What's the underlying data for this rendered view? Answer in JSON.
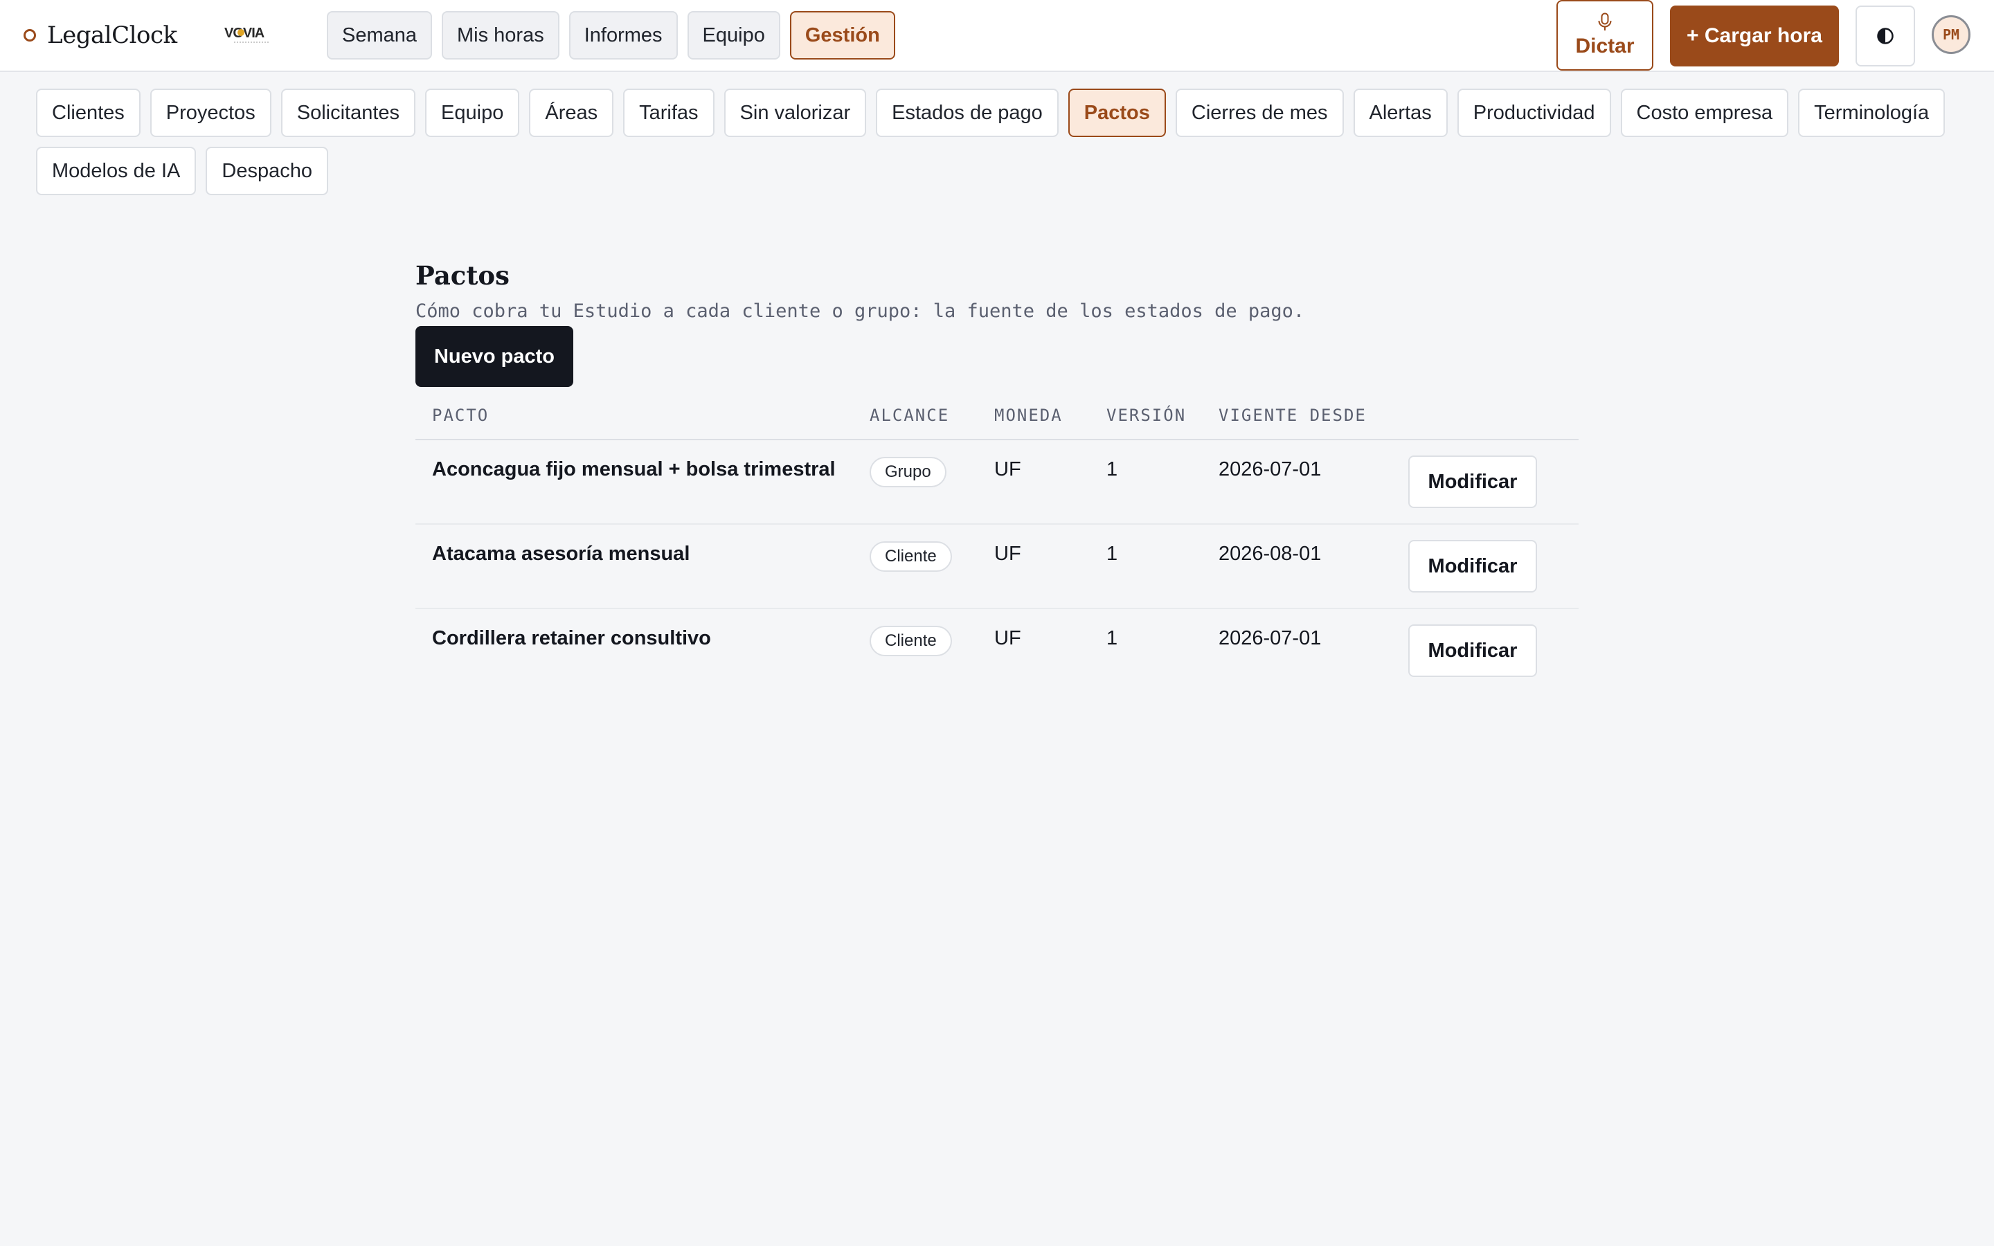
{
  "brand": {
    "name": "LegalClock",
    "partner_logo_text": "VOVIA"
  },
  "nav": [
    {
      "label": "Semana",
      "active": false
    },
    {
      "label": "Mis horas",
      "active": false
    },
    {
      "label": "Informes",
      "active": false
    },
    {
      "label": "Equipo",
      "active": false
    },
    {
      "label": "Gestión",
      "active": true
    }
  ],
  "actions": {
    "dictar_label": "Dictar",
    "cargar_label": "+ Cargar hora",
    "theme_icon": "contrast-icon",
    "avatar_initials": "PM"
  },
  "subnav": [
    {
      "label": "Clientes",
      "active": false
    },
    {
      "label": "Proyectos",
      "active": false
    },
    {
      "label": "Solicitantes",
      "active": false
    },
    {
      "label": "Equipo",
      "active": false
    },
    {
      "label": "Áreas",
      "active": false
    },
    {
      "label": "Tarifas",
      "active": false
    },
    {
      "label": "Sin valorizar",
      "active": false
    },
    {
      "label": "Estados de pago",
      "active": false
    },
    {
      "label": "Pactos",
      "active": true
    },
    {
      "label": "Cierres de mes",
      "active": false
    },
    {
      "label": "Alertas",
      "active": false
    },
    {
      "label": "Productividad",
      "active": false
    },
    {
      "label": "Costo empresa",
      "active": false
    },
    {
      "label": "Terminología",
      "active": false
    },
    {
      "label": "Modelos de IA",
      "active": false
    },
    {
      "label": "Despacho",
      "active": false
    }
  ],
  "page": {
    "title": "Pactos",
    "description": "Cómo cobra tu Estudio a cada cliente o grupo: la fuente de los estados de pago.",
    "new_button": "Nuevo pacto"
  },
  "table": {
    "columns": [
      "PACTO",
      "ALCANCE",
      "MONEDA",
      "VERSIÓN",
      "VIGENTE DESDE",
      ""
    ],
    "rows": [
      {
        "pacto": "Aconcagua fijo mensual + bolsa trimestral",
        "alcance": "Grupo",
        "moneda": "UF",
        "version": "1",
        "vigente": "2026-07-01",
        "action": "Modificar"
      },
      {
        "pacto": "Atacama asesoría mensual",
        "alcance": "Cliente",
        "moneda": "UF",
        "version": "1",
        "vigente": "2026-08-01",
        "action": "Modificar"
      },
      {
        "pacto": "Cordillera retainer consultivo",
        "alcance": "Cliente",
        "moneda": "UF",
        "version": "1",
        "vigente": "2026-07-01",
        "action": "Modificar"
      }
    ]
  },
  "colors": {
    "accent": "#9a4a1a",
    "accent_bg": "#fbe9dc",
    "dark": "#14171f",
    "page_bg": "#f5f6f8"
  }
}
